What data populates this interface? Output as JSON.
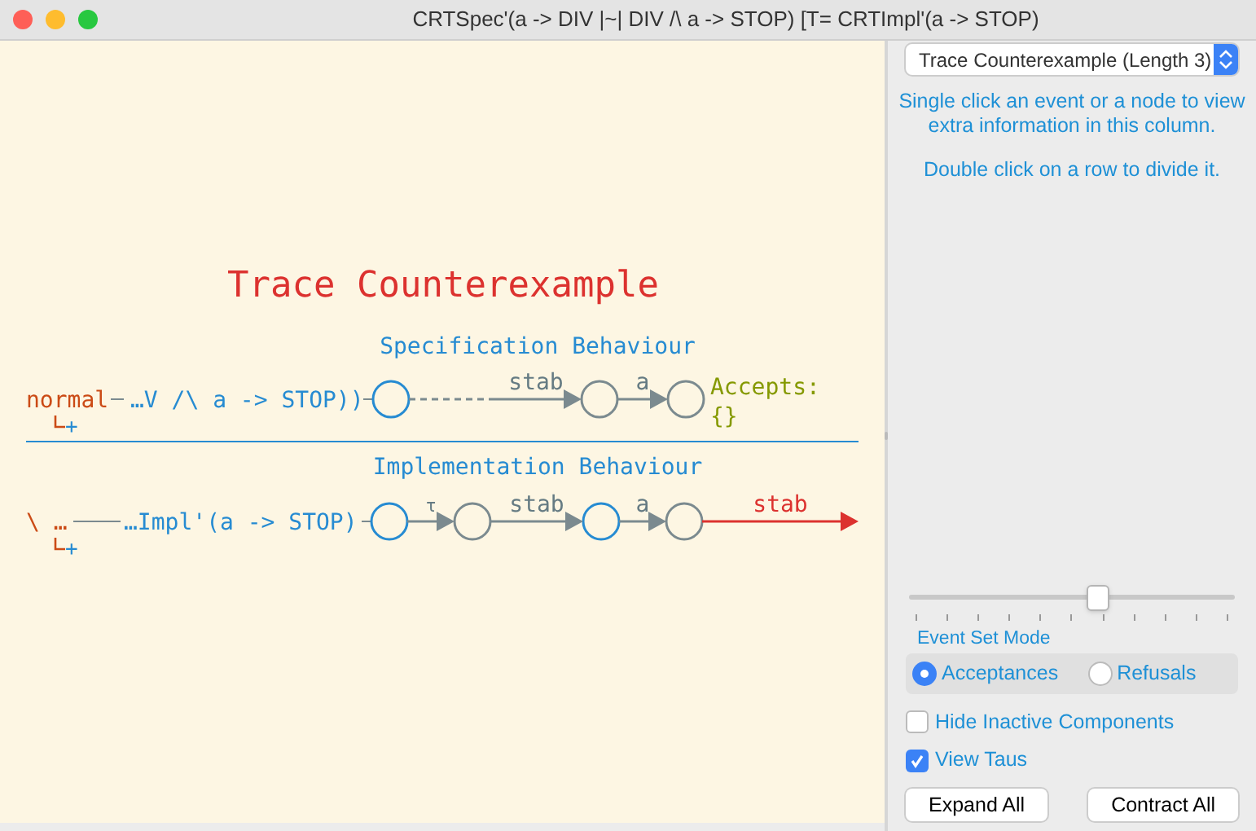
{
  "window": {
    "title": "CRTSpec'(a -> DIV |~| DIV /\\ a -> STOP) [T= CRTImpl'(a -> STOP)"
  },
  "diagram": {
    "heading": "Trace Counterexample",
    "rows": [
      {
        "caption": "Specification Behaviour",
        "prefix": "normal",
        "expand": "+",
        "process": "…V /\\ a -> STOP))",
        "nodes": [
          {
            "active": true
          },
          {
            "active": false
          },
          {
            "active": false
          }
        ],
        "edges": [
          {
            "label": "stab",
            "kind": "dashed"
          },
          {
            "label": "a",
            "kind": "event"
          }
        ],
        "result": {
          "title": "Accepts:",
          "value": "{}"
        }
      },
      {
        "caption": "Implementation Behaviour",
        "prefix": "\\ …",
        "expand": "+",
        "process": "…Impl'(a -> STOP)",
        "nodes": [
          {
            "active": true
          },
          {
            "active": false
          },
          {
            "active": true
          },
          {
            "active": false
          }
        ],
        "edges": [
          {
            "label": "τ",
            "kind": "tau"
          },
          {
            "label": "stab",
            "kind": "event"
          },
          {
            "label": "a",
            "kind": "event"
          },
          {
            "label": "stab",
            "kind": "failure"
          }
        ]
      }
    ]
  },
  "sidebar": {
    "select": "Trace Counterexample (Length 3)",
    "hints": [
      "Single click an event or a node to view extra information in this column.",
      "Double click on a row to divide it."
    ],
    "slider": {
      "level": 0.58
    },
    "mode_label": "Event Set Mode",
    "modes": [
      {
        "label": "Acceptances",
        "selected": true
      },
      {
        "label": "Refusals",
        "selected": false
      }
    ],
    "options": [
      {
        "label": "Hide Inactive Components",
        "checked": false
      },
      {
        "label": "View Taus",
        "checked": true
      }
    ],
    "buttons": [
      "Expand All",
      "Contract All"
    ]
  }
}
